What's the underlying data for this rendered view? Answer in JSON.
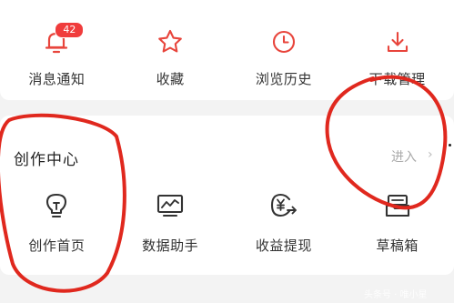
{
  "quick_actions": [
    {
      "label": "消息通知",
      "icon": "bell-icon",
      "badge": "42"
    },
    {
      "label": "收藏",
      "icon": "star-icon"
    },
    {
      "label": "浏览历史",
      "icon": "clock-icon"
    },
    {
      "label": "下载管理",
      "icon": "download-icon"
    }
  ],
  "creator_center": {
    "title": "创作中心",
    "enter_label": "进入",
    "enter_arrow": "›",
    "items": [
      {
        "label": "创作首页",
        "icon": "lightbulb-icon"
      },
      {
        "label": "数据助手",
        "icon": "chart-icon"
      },
      {
        "label": "收益提现",
        "icon": "withdraw-icon"
      },
      {
        "label": "草稿箱",
        "icon": "drafts-icon"
      }
    ]
  },
  "watermark": "头条号 · 唯小星",
  "colors": {
    "accent": "#e8453c",
    "annotation": "#e0281e",
    "text": "#333333",
    "muted": "#aaaaaa"
  }
}
